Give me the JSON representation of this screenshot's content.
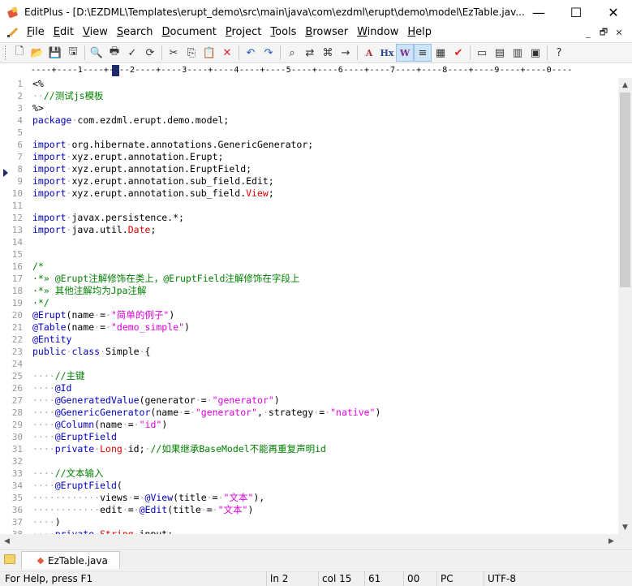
{
  "window": {
    "title": "EditPlus - [D:\\EZDML\\Templates\\erupt_demo\\src\\main\\java\\com\\ezdml\\erupt\\demo\\model\\EzTable.jav...",
    "minimize": "—",
    "maximize": "☐",
    "close": "✕"
  },
  "menu": {
    "items": [
      "File",
      "Edit",
      "View",
      "Search",
      "Document",
      "Project",
      "Tools",
      "Browser",
      "Window",
      "Help"
    ],
    "underline": [
      "F",
      "E",
      "V",
      "S",
      "D",
      "P",
      "T",
      "B",
      "W",
      "H"
    ],
    "mdi": [
      "_",
      "🗗",
      "✕"
    ]
  },
  "toolbar": {
    "icons": [
      "new-file-icon",
      "open-folder-icon",
      "save-icon",
      "save-all-icon",
      "print-preview-icon",
      "print-icon",
      "spell-check-icon",
      "browser-preview-icon",
      "cut-icon",
      "copy-icon",
      "paste-icon",
      "delete-icon",
      "undo-icon",
      "redo-icon",
      "find-icon",
      "replace-icon",
      "find-in-files-icon",
      "goto-line-icon",
      "font-icon",
      "hex-icon",
      "word-wrap-icon",
      "ruler-icon",
      "column-select-icon",
      "check-icon",
      "window-icon",
      "cliptext-icon",
      "directory-icon",
      "output-icon",
      "help-icon"
    ]
  },
  "ruler": {
    "text": "----+----1----+----2----+----3----+----4----+----5----+----6----+----7----+----8----+----9----+----0----"
  },
  "editor": {
    "lines": [
      {
        "n": "1",
        "parts": [
          [
            "o",
            "<%"
          ]
        ]
      },
      {
        "n": "2",
        "parts": [
          [
            "w",
            "··"
          ],
          [
            "c",
            "//测试js模板"
          ]
        ]
      },
      {
        "n": "3",
        "parts": [
          [
            "o",
            "%>"
          ]
        ]
      },
      {
        "n": "4",
        "parts": [
          [
            "k",
            "package"
          ],
          [
            "w",
            "·"
          ],
          [
            "o",
            "com.ezdml.erupt.demo.model;"
          ]
        ]
      },
      {
        "n": "5",
        "parts": []
      },
      {
        "n": "6",
        "parts": [
          [
            "k",
            "import"
          ],
          [
            "w",
            "·"
          ],
          [
            "o",
            "org.hibernate.annotations.GenericGenerator;"
          ]
        ]
      },
      {
        "n": "7",
        "parts": [
          [
            "k",
            "import"
          ],
          [
            "w",
            "·"
          ],
          [
            "o",
            "xyz.erupt.annotation.Erupt;"
          ]
        ]
      },
      {
        "n": "8",
        "parts": [
          [
            "k",
            "import"
          ],
          [
            "w",
            "·"
          ],
          [
            "o",
            "xyz.erupt.annotation.EruptField;"
          ]
        ]
      },
      {
        "n": "9",
        "parts": [
          [
            "k",
            "import"
          ],
          [
            "w",
            "·"
          ],
          [
            "o",
            "xyz.erupt.annotation.sub_field.Edit;"
          ]
        ]
      },
      {
        "n": "10",
        "parts": [
          [
            "k",
            "import"
          ],
          [
            "w",
            "·"
          ],
          [
            "o",
            "xyz.erupt.annotation.sub_field."
          ],
          [
            "t",
            "View"
          ],
          [
            "o",
            ";"
          ]
        ]
      },
      {
        "n": "11",
        "parts": []
      },
      {
        "n": "12",
        "parts": [
          [
            "k",
            "import"
          ],
          [
            "w",
            "·"
          ],
          [
            "o",
            "javax.persistence.*;"
          ]
        ]
      },
      {
        "n": "13",
        "parts": [
          [
            "k",
            "import"
          ],
          [
            "w",
            "·"
          ],
          [
            "o",
            "java.util."
          ],
          [
            "t",
            "Date"
          ],
          [
            "o",
            ";"
          ]
        ]
      },
      {
        "n": "14",
        "parts": []
      },
      {
        "n": "15",
        "parts": []
      },
      {
        "n": "16",
        "parts": [
          [
            "c",
            "/*"
          ]
        ]
      },
      {
        "n": "17",
        "parts": [
          [
            "c",
            "·*» @Erupt注解修饰在类上，@EruptField注解修饰在字段上"
          ]
        ]
      },
      {
        "n": "18",
        "parts": [
          [
            "c",
            "·*» 其他注解均为Jpa注解"
          ]
        ]
      },
      {
        "n": "19",
        "parts": [
          [
            "c",
            "·*/"
          ]
        ]
      },
      {
        "n": "20",
        "parts": [
          [
            "a",
            "@Erupt"
          ],
          [
            "o",
            "(name"
          ],
          [
            "w",
            "·"
          ],
          [
            "o",
            "="
          ],
          [
            "w",
            "·"
          ],
          [
            "s",
            "\"简单的例子\""
          ],
          [
            "o",
            ")"
          ]
        ]
      },
      {
        "n": "21",
        "parts": [
          [
            "a",
            "@Table"
          ],
          [
            "o",
            "(name"
          ],
          [
            "w",
            "·"
          ],
          [
            "o",
            "="
          ],
          [
            "w",
            "·"
          ],
          [
            "s",
            "\"demo_simple\""
          ],
          [
            "o",
            ")"
          ]
        ]
      },
      {
        "n": "22",
        "parts": [
          [
            "a",
            "@Entity"
          ]
        ]
      },
      {
        "n": "23",
        "parts": [
          [
            "k",
            "public"
          ],
          [
            "w",
            "·"
          ],
          [
            "k",
            "class"
          ],
          [
            "w",
            "·"
          ],
          [
            "o",
            "Simple"
          ],
          [
            "w",
            "·"
          ],
          [
            "o",
            "{"
          ]
        ]
      },
      {
        "n": "24",
        "parts": []
      },
      {
        "n": "25",
        "parts": [
          [
            "w",
            "····"
          ],
          [
            "c",
            "//主键"
          ]
        ]
      },
      {
        "n": "26",
        "parts": [
          [
            "w",
            "····"
          ],
          [
            "a",
            "@Id"
          ]
        ]
      },
      {
        "n": "27",
        "parts": [
          [
            "w",
            "····"
          ],
          [
            "a",
            "@GeneratedValue"
          ],
          [
            "o",
            "(generator"
          ],
          [
            "w",
            "·"
          ],
          [
            "o",
            "="
          ],
          [
            "w",
            "·"
          ],
          [
            "s",
            "\"generator\""
          ],
          [
            "o",
            ")"
          ]
        ]
      },
      {
        "n": "28",
        "parts": [
          [
            "w",
            "····"
          ],
          [
            "a",
            "@GenericGenerator"
          ],
          [
            "o",
            "(name"
          ],
          [
            "w",
            "·"
          ],
          [
            "o",
            "="
          ],
          [
            "w",
            "·"
          ],
          [
            "s",
            "\"generator\""
          ],
          [
            "o",
            ","
          ],
          [
            "w",
            "·"
          ],
          [
            "o",
            "strategy"
          ],
          [
            "w",
            "·"
          ],
          [
            "o",
            "="
          ],
          [
            "w",
            "·"
          ],
          [
            "s",
            "\"native\""
          ],
          [
            "o",
            ")"
          ]
        ]
      },
      {
        "n": "29",
        "parts": [
          [
            "w",
            "····"
          ],
          [
            "a",
            "@Column"
          ],
          [
            "o",
            "(name"
          ],
          [
            "w",
            "·"
          ],
          [
            "o",
            "="
          ],
          [
            "w",
            "·"
          ],
          [
            "s",
            "\"id\""
          ],
          [
            "o",
            ")"
          ]
        ]
      },
      {
        "n": "30",
        "parts": [
          [
            "w",
            "····"
          ],
          [
            "a",
            "@EruptField"
          ]
        ]
      },
      {
        "n": "31",
        "parts": [
          [
            "w",
            "····"
          ],
          [
            "k",
            "private"
          ],
          [
            "w",
            "·"
          ],
          [
            "t",
            "Long"
          ],
          [
            "w",
            "·"
          ],
          [
            "o",
            "id;"
          ],
          [
            "w",
            "·"
          ],
          [
            "c",
            "//如果继承BaseModel不能再重复声明id"
          ]
        ]
      },
      {
        "n": "32",
        "parts": []
      },
      {
        "n": "33",
        "parts": [
          [
            "w",
            "····"
          ],
          [
            "c",
            "//文本输入"
          ]
        ]
      },
      {
        "n": "34",
        "parts": [
          [
            "w",
            "····"
          ],
          [
            "a",
            "@EruptField"
          ],
          [
            "o",
            "("
          ]
        ]
      },
      {
        "n": "35",
        "parts": [
          [
            "w",
            "············"
          ],
          [
            "o",
            "views"
          ],
          [
            "w",
            "·"
          ],
          [
            "o",
            "="
          ],
          [
            "w",
            "·"
          ],
          [
            "a",
            "@View"
          ],
          [
            "o",
            "(title"
          ],
          [
            "w",
            "·"
          ],
          [
            "o",
            "="
          ],
          [
            "w",
            "·"
          ],
          [
            "s",
            "\"文本\""
          ],
          [
            "o",
            "),"
          ]
        ]
      },
      {
        "n": "36",
        "parts": [
          [
            "w",
            "············"
          ],
          [
            "o",
            "edit"
          ],
          [
            "w",
            "·"
          ],
          [
            "o",
            "="
          ],
          [
            "w",
            "·"
          ],
          [
            "a",
            "@Edit"
          ],
          [
            "o",
            "(title"
          ],
          [
            "w",
            "·"
          ],
          [
            "o",
            "="
          ],
          [
            "w",
            "·"
          ],
          [
            "s",
            "\"文本\""
          ],
          [
            "o",
            ")"
          ]
        ]
      },
      {
        "n": "37",
        "parts": [
          [
            "w",
            "····"
          ],
          [
            "o",
            ")"
          ]
        ]
      },
      {
        "n": "38",
        "parts": [
          [
            "w",
            "····"
          ],
          [
            "k",
            "private"
          ],
          [
            "w",
            "·"
          ],
          [
            "t",
            "String"
          ],
          [
            "w",
            "·"
          ],
          [
            "o",
            "input;"
          ]
        ]
      }
    ]
  },
  "tabs": {
    "active_file": "EzTable.java"
  },
  "status": {
    "help": "For Help, press F1",
    "line": "ln 2",
    "col": "col 15",
    "num": "61",
    "code": "00",
    "mode": "PC",
    "encoding": "UTF-8"
  },
  "colors": {
    "keyword": "#0000c0",
    "comment": "#008000",
    "string": "#e000e0",
    "type": "#e00000"
  }
}
